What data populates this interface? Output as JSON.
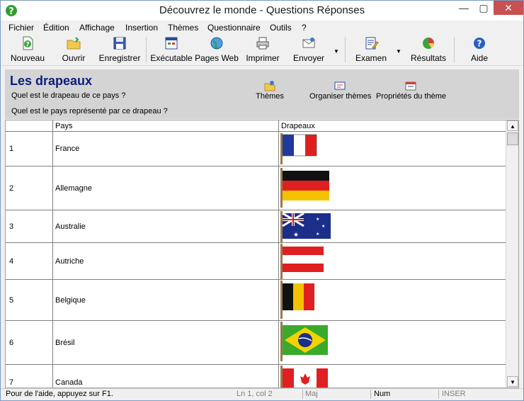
{
  "title": "Découvrez le monde - Questions Réponses",
  "window_controls": {
    "minimize": "—",
    "maximize": "▢",
    "close": "✕"
  },
  "menu": [
    "Fichier",
    "Édition",
    "Affichage",
    "Insertion",
    "Thèmes",
    "Questionnaire",
    "Outils",
    "?"
  ],
  "toolbar": {
    "nouveau": "Nouveau",
    "ouvrir": "Ouvrir",
    "enregistrer": "Enregistrer",
    "executable": "Exécutable",
    "pages_web": "Pages Web",
    "imprimer": "Imprimer",
    "envoyer": "Envoyer",
    "examen": "Examen",
    "resultats": "Résultats",
    "aide": "Aide",
    "dropdown_glyph": "▼"
  },
  "header": {
    "title": "Les drapeaux",
    "question1": "Quel est le drapeau de ce pays ?",
    "question2": "Quel est le pays représenté par ce drapeau ?",
    "themes": "Thèmes",
    "organiser": "Organiser thèmes",
    "proprietes": "Propriétés du thème"
  },
  "grid": {
    "columns": [
      "Pays",
      "Drapeaux"
    ],
    "rows": [
      {
        "num": "1",
        "name": "France"
      },
      {
        "num": "2",
        "name": "Allemagne"
      },
      {
        "num": "3",
        "name": "Australie"
      },
      {
        "num": "4",
        "name": "Autriche"
      },
      {
        "num": "5",
        "name": "Belgique"
      },
      {
        "num": "6",
        "name": "Brésil"
      },
      {
        "num": "7",
        "name": "Canada"
      }
    ],
    "scroll_up": "▲",
    "scroll_down": "▼"
  },
  "status": {
    "help": "Pour de l'aide, appuyez sur F1.",
    "position": "Ln 1, col 2",
    "maj": "Maj",
    "num": "Num",
    "inser": "INSER"
  },
  "colors": {
    "title_blue": "#0a1f7a",
    "band": "#d4d4d4",
    "close_red": "#c75050"
  }
}
